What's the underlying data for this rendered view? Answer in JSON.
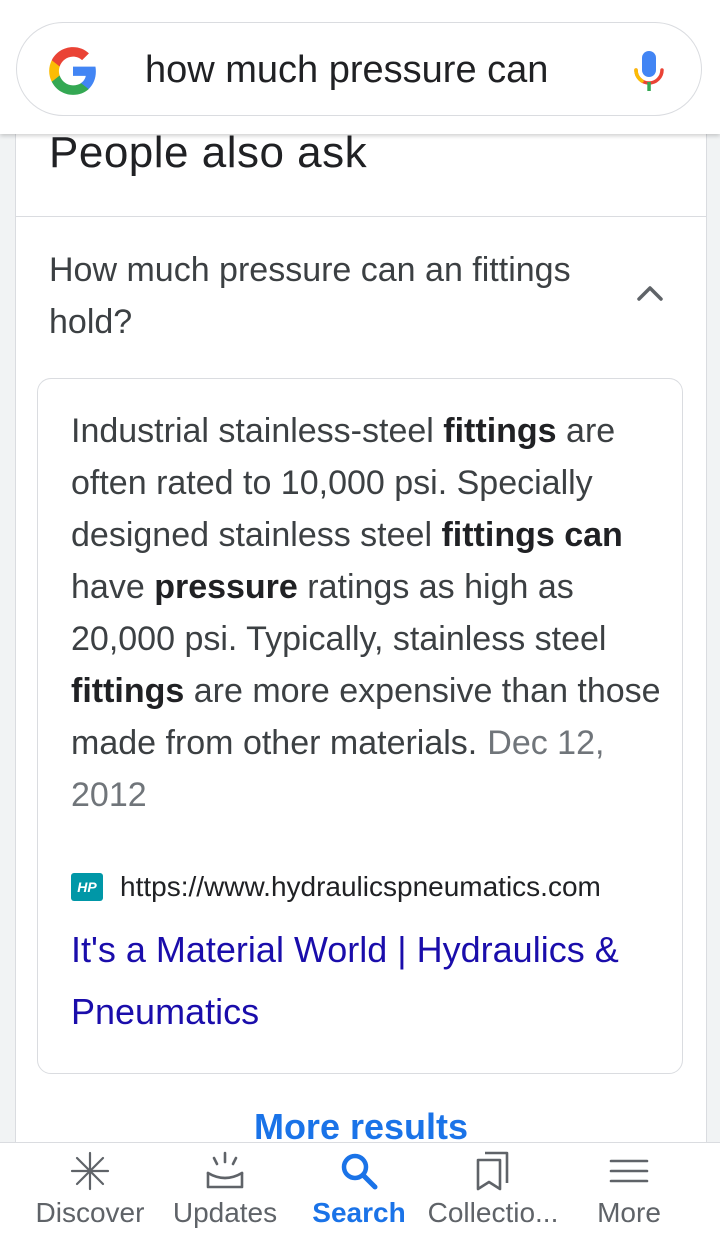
{
  "search": {
    "query": "how much pressure can"
  },
  "card": {
    "section_title": "People also ask",
    "question": "How much pressure can an fittings hold?",
    "answer": {
      "segments": [
        {
          "text": "Industrial stainless-steel ",
          "bold": false
        },
        {
          "text": "fittings",
          "bold": true
        },
        {
          "text": " are often rated to 10,000 psi. Specially designed stainless steel ",
          "bold": false
        },
        {
          "text": "fittings can",
          "bold": true
        },
        {
          "text": " have ",
          "bold": false
        },
        {
          "text": "pressure",
          "bold": true
        },
        {
          "text": " ratings as high as 20,000 psi. Typically, stainless steel ",
          "bold": false
        },
        {
          "text": "fittings",
          "bold": true
        },
        {
          "text": " are more expensive than those made from other materials.",
          "bold": false
        }
      ],
      "date": "Dec 12, 2012"
    },
    "source": {
      "favicon_text": "HP",
      "url": "https://www.hydraulicspneumatics.com",
      "title": "It's a Material World | Hydraulics & Pneumatics"
    },
    "more_results": "More results"
  },
  "bottom_nav": {
    "items": [
      {
        "label": "Discover",
        "icon": "discover-icon",
        "active": false
      },
      {
        "label": "Updates",
        "icon": "updates-icon",
        "active": false
      },
      {
        "label": "Search",
        "icon": "search-icon",
        "active": true
      },
      {
        "label": "Collectio...",
        "icon": "collections-icon",
        "active": false
      },
      {
        "label": "More",
        "icon": "menu-icon",
        "active": false
      }
    ]
  },
  "colors": {
    "link": "#1a0dab",
    "accent": "#1a73e8",
    "favicon_bg": "#0097a7"
  }
}
